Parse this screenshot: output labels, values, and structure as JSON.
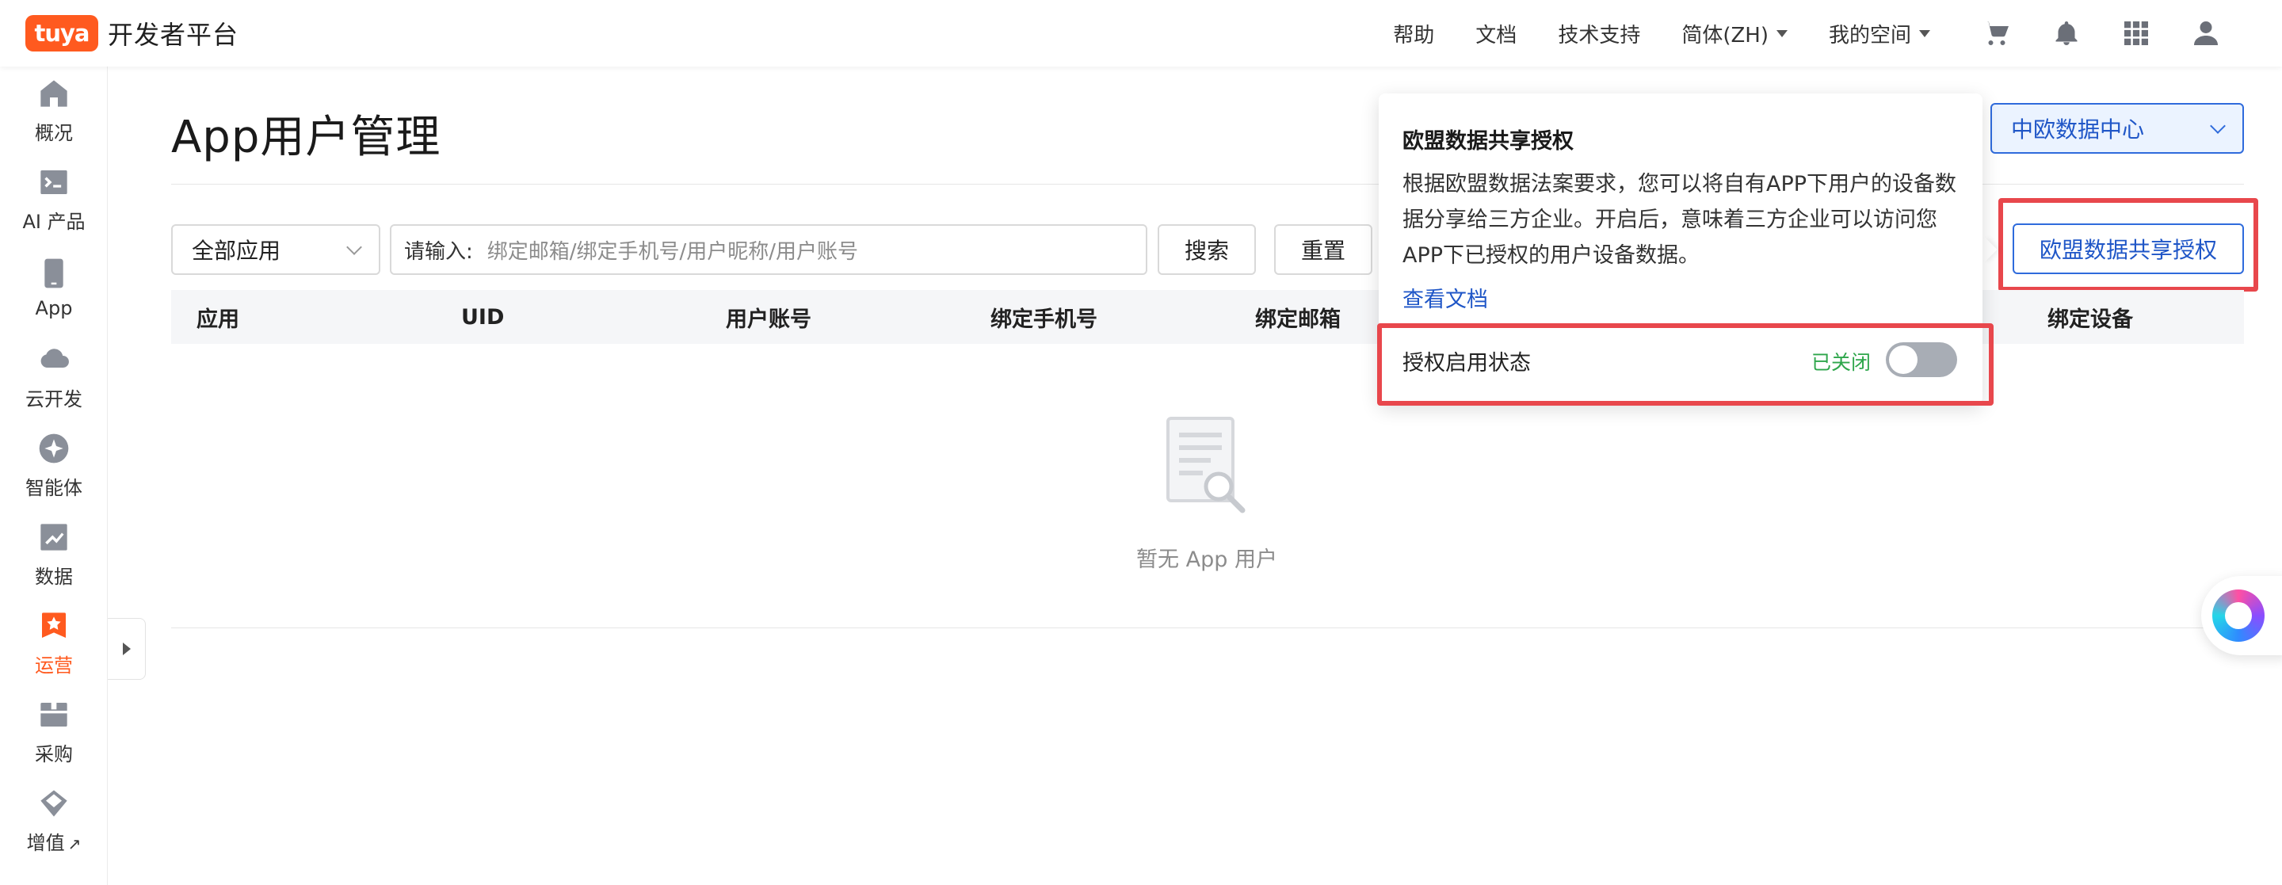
{
  "header": {
    "logo_text": "tuya",
    "platform_title": "开发者平台",
    "nav": {
      "help": "帮助",
      "docs": "文档",
      "support": "技术支持",
      "language": "简体(ZH)",
      "workspace": "我的空间"
    },
    "icons": [
      "cart-icon",
      "bell-icon",
      "apps-grid-icon",
      "user-icon"
    ]
  },
  "sidebar": {
    "items": [
      {
        "label": "概况",
        "icon": "home-icon"
      },
      {
        "label": "AI 产品",
        "icon": "terminal-icon"
      },
      {
        "label": "App",
        "icon": "phone-icon"
      },
      {
        "label": "云开发",
        "icon": "cloud-icon"
      },
      {
        "label": "智能体",
        "icon": "sparkle-icon"
      },
      {
        "label": "数据",
        "icon": "chart-icon"
      },
      {
        "label": "运营",
        "icon": "bookmark-icon",
        "active": true
      },
      {
        "label": "采购",
        "icon": "box-icon"
      },
      {
        "label": "增值",
        "icon": "diamond-icon",
        "external": "↗"
      }
    ]
  },
  "main": {
    "title": "App用户管理",
    "region_select": "中欧数据中心",
    "filters": {
      "app_select": "全部应用",
      "search_prefix": "请输入:",
      "search_placeholder": "绑定邮箱/绑定手机号/用户昵称/用户账号",
      "search_button": "搜索",
      "reset_button": "重置"
    },
    "eu_share_button": "欧盟数据共享授权",
    "table": {
      "columns": [
        "应用",
        "UID",
        "用户账号",
        "绑定手机号",
        "绑定邮箱",
        "绑定设备"
      ]
    },
    "empty_text": "暂无 App 用户"
  },
  "popover": {
    "title": "欧盟数据共享授权",
    "description": "根据欧盟数据法案要求，您可以将自有APP下用户的设备数据分享给三方企业。开启后，意味着三方企业可以访问您 APP下已授权的用户设备数据。",
    "doc_link": "查看文档",
    "status_label": "授权启用状态",
    "status_text": "已关闭",
    "status_color": "#2ea64b",
    "toggle_on": false
  },
  "colors": {
    "brand": "#ff5a1f",
    "link": "#1f56c7",
    "highlight": "#e8474c"
  }
}
